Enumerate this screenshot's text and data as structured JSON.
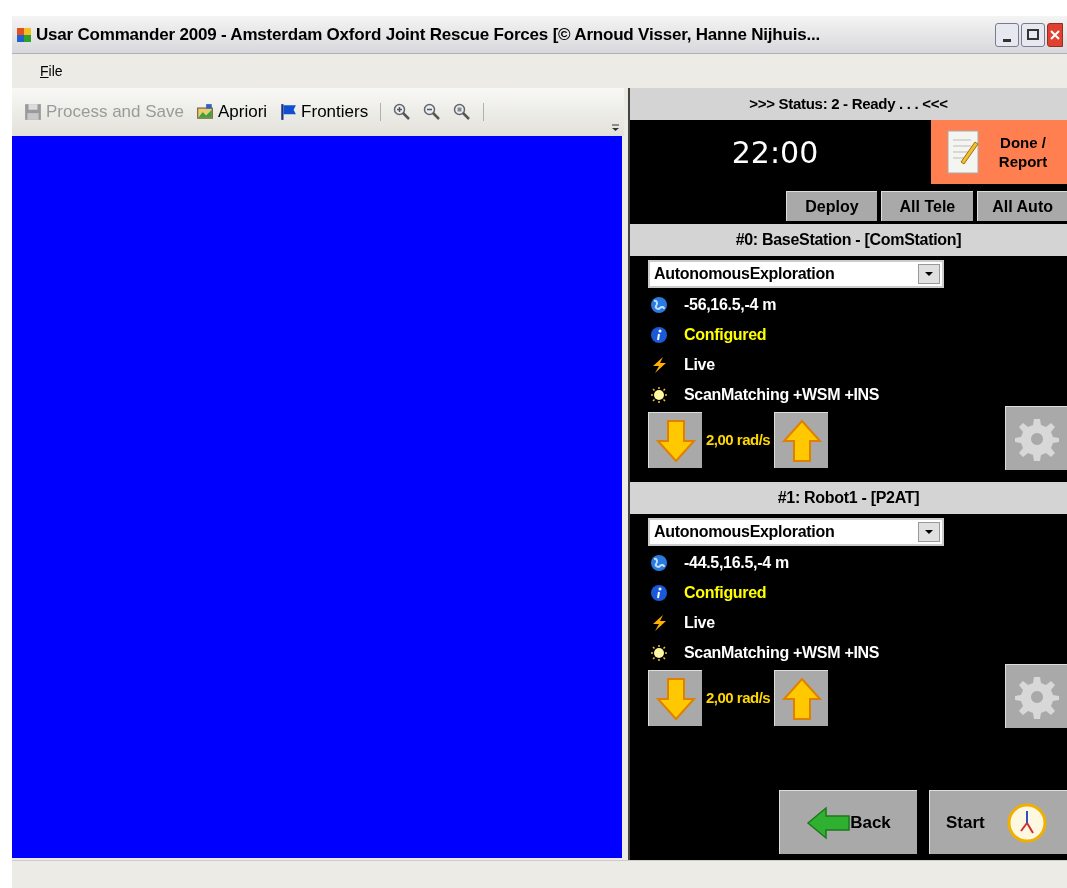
{
  "window": {
    "title": "Usar Commander 2009 - Amsterdam Oxford Joint Rescue Forces [© Arnoud Visser, Hanne Nijhuis..."
  },
  "menu": [
    {
      "label": "File"
    }
  ],
  "toolbar": [
    {
      "kind": "save",
      "label": "Process and Save",
      "disabled": true
    },
    {
      "kind": "apriori",
      "label": "Apriori",
      "disabled": false
    },
    {
      "kind": "frontiers",
      "label": "Frontiers",
      "disabled": false
    },
    {
      "kind": "separator"
    },
    {
      "kind": "zoom-in"
    },
    {
      "kind": "zoom-out"
    },
    {
      "kind": "zoom-fit"
    },
    {
      "kind": "separator"
    }
  ],
  "status": {
    "text": ">>> Status: 2 - Ready . . . <<<",
    "time": "22:00",
    "report_button": "Done / Report"
  },
  "team_buttons": [
    "Deploy",
    "All Tele",
    "All Auto"
  ],
  "robots": [
    {
      "header": "#0: BaseStation - [ComStation]",
      "mode": "AutonomousExploration",
      "info": [
        {
          "kind": "position",
          "text": "-56,16.5,-4 m"
        },
        {
          "kind": "state",
          "text": "Configured"
        },
        {
          "kind": "power",
          "text": "Live"
        },
        {
          "kind": "localization",
          "text": "ScanMatching +WSM +INS"
        }
      ],
      "speed": "2,00 rad/s"
    },
    {
      "header": "#1: Robot1 - [P2AT]",
      "mode": "AutonomousExploration",
      "info": [
        {
          "kind": "position",
          "text": "-44.5,16.5,-4 m"
        },
        {
          "kind": "state",
          "text": "Configured"
        },
        {
          "kind": "power",
          "text": "Live"
        },
        {
          "kind": "localization",
          "text": "ScanMatching +WSM +INS"
        }
      ],
      "speed": "2,00 rad/s"
    }
  ],
  "footer_buttons": [
    {
      "kind": "back",
      "label": "Back"
    },
    {
      "kind": "start",
      "label": "Start"
    }
  ]
}
